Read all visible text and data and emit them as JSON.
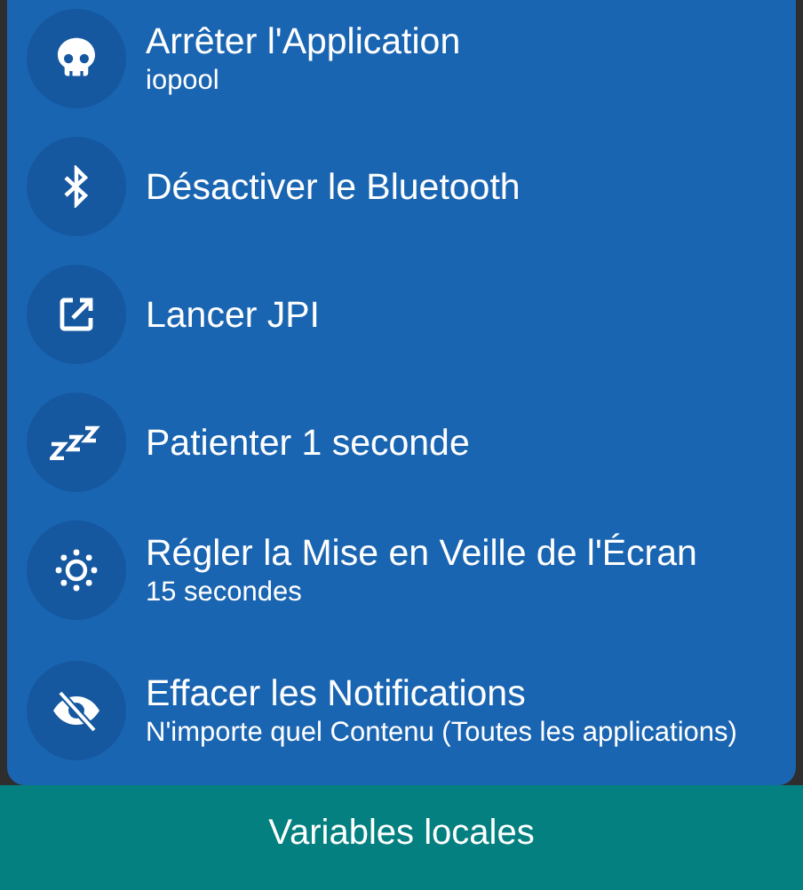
{
  "actions": [
    {
      "kind": "skull",
      "title": "Arrêter l'Application",
      "subtitle": "iopool"
    },
    {
      "kind": "bluetooth",
      "title": "Désactiver le Bluetooth"
    },
    {
      "kind": "launch",
      "title": "Lancer JPI"
    },
    {
      "kind": "sleep",
      "title": "Patienter 1 seconde"
    },
    {
      "kind": "brightness",
      "title": "Régler la Mise en Veille de l'Écran",
      "subtitle": "15 secondes"
    },
    {
      "kind": "eye-off",
      "title": "Effacer les Notifications",
      "subtitle": "N'importe quel Contenu (Toutes les applications)"
    }
  ],
  "bottom_button": "Variables locales"
}
